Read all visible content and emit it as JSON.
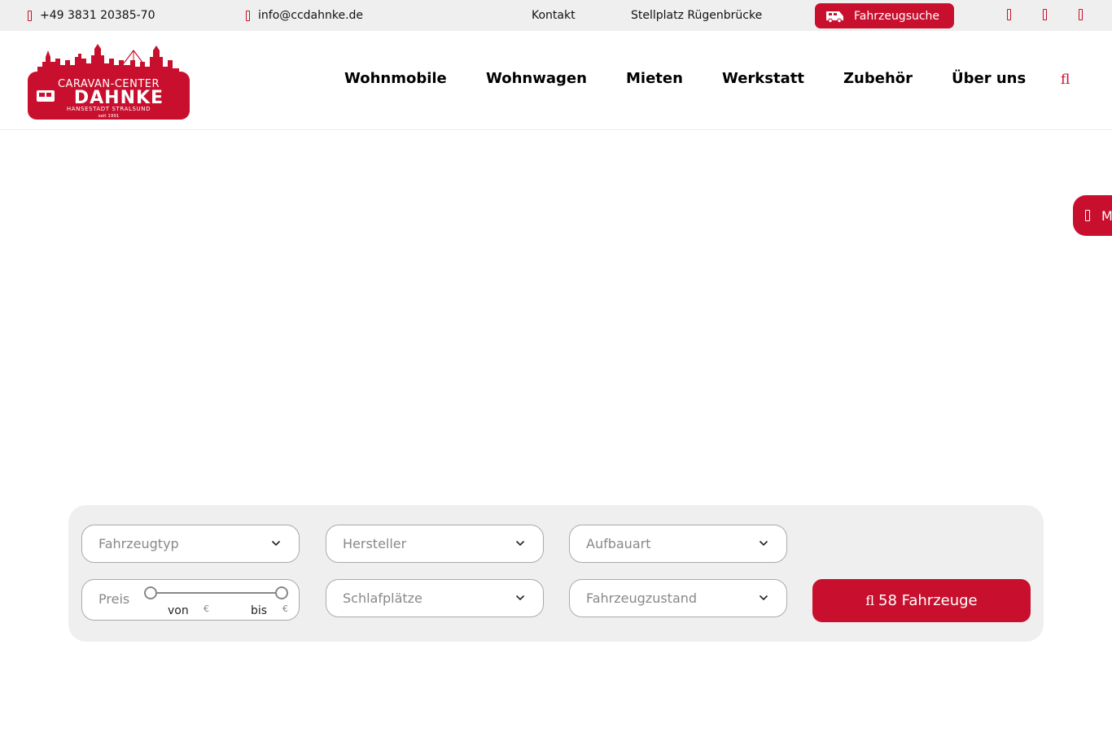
{
  "topbar": {
    "phone": "+49 3831 20385-70",
    "email": "info@ccdahnke.de",
    "links": [
      "Kontakt",
      "Stellplatz Rügenbrücke"
    ],
    "vehicle_search_label": "Fahrzeugsuche",
    "social_icons": [
      "facebook-icon",
      "instagram-icon",
      "youtube-icon"
    ]
  },
  "logo": {
    "line1": "CARAVAN-CENTER",
    "line2": "DAHNKE",
    "line3": "HANSESTADT STRALSUND",
    "line4": "seit 1991"
  },
  "nav": {
    "items": [
      "Wohnmobile",
      "Wohnwagen",
      "Mieten",
      "Werkstatt",
      "Zubehör",
      "Über uns"
    ],
    "search_icon": "search-icon"
  },
  "side_tab": {
    "label": "M"
  },
  "search_panel": {
    "vehicle_type": "Fahrzeugtyp",
    "manufacturer": "Hersteller",
    "body_type": "Aufbauart",
    "sleeping_places": "Schlafplätze",
    "condition": "Fahrzeugzustand",
    "price": {
      "label": "Preis",
      "from_label": "von",
      "to_label": "bis",
      "currency": "€"
    },
    "submit_label": "58 Fahrzeuge",
    "submit_icon_glyph": "fl"
  },
  "colors": {
    "brand_red": "#c8102e",
    "topbar_bg": "#efefef",
    "panel_bg": "#efefef"
  }
}
